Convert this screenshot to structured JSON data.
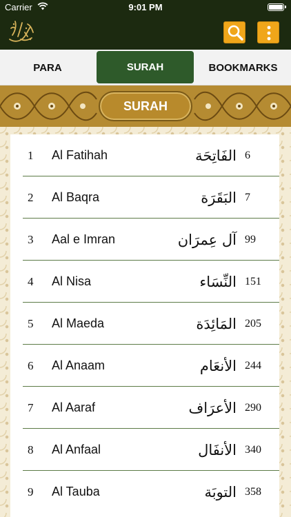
{
  "status_bar": {
    "carrier": "Carrier",
    "time": "9:01 PM"
  },
  "header": {
    "logo": "quran-calligraphy-logo",
    "search_icon": "search-icon",
    "menu_icon": "vertical-dots-icon",
    "accent": "#f0a61a",
    "background": "#1c2a10"
  },
  "tabs": [
    {
      "label": "PARA",
      "selected": false
    },
    {
      "label": "SURAH",
      "selected": true
    },
    {
      "label": "BOOKMARKS",
      "selected": false
    }
  ],
  "banner": {
    "title": "SURAH"
  },
  "surahs": [
    {
      "number": "1",
      "name": "Al Fatihah",
      "arabic": "الفَاتِحَة",
      "page": "6"
    },
    {
      "number": "2",
      "name": "Al Baqra",
      "arabic": "البَقَرَة",
      "page": "7"
    },
    {
      "number": "3",
      "name": "Aal e Imran",
      "arabic": "آل عِمرَان",
      "page": "99"
    },
    {
      "number": "4",
      "name": "Al Nisa",
      "arabic": "النِّسَاء",
      "page": "151"
    },
    {
      "number": "5",
      "name": "Al Maeda",
      "arabic": "المَائِدَة",
      "page": "205"
    },
    {
      "number": "6",
      "name": "Al Anaam",
      "arabic": "الأنعَام",
      "page": "244"
    },
    {
      "number": "7",
      "name": "Al Aaraf",
      "arabic": "الأعرَاف",
      "page": "290"
    },
    {
      "number": "8",
      "name": "Al Anfaal",
      "arabic": "الأنفَال",
      "page": "340"
    },
    {
      "number": "9",
      "name": "Al Tauba",
      "arabic": "التوبَة",
      "page": "358"
    }
  ]
}
